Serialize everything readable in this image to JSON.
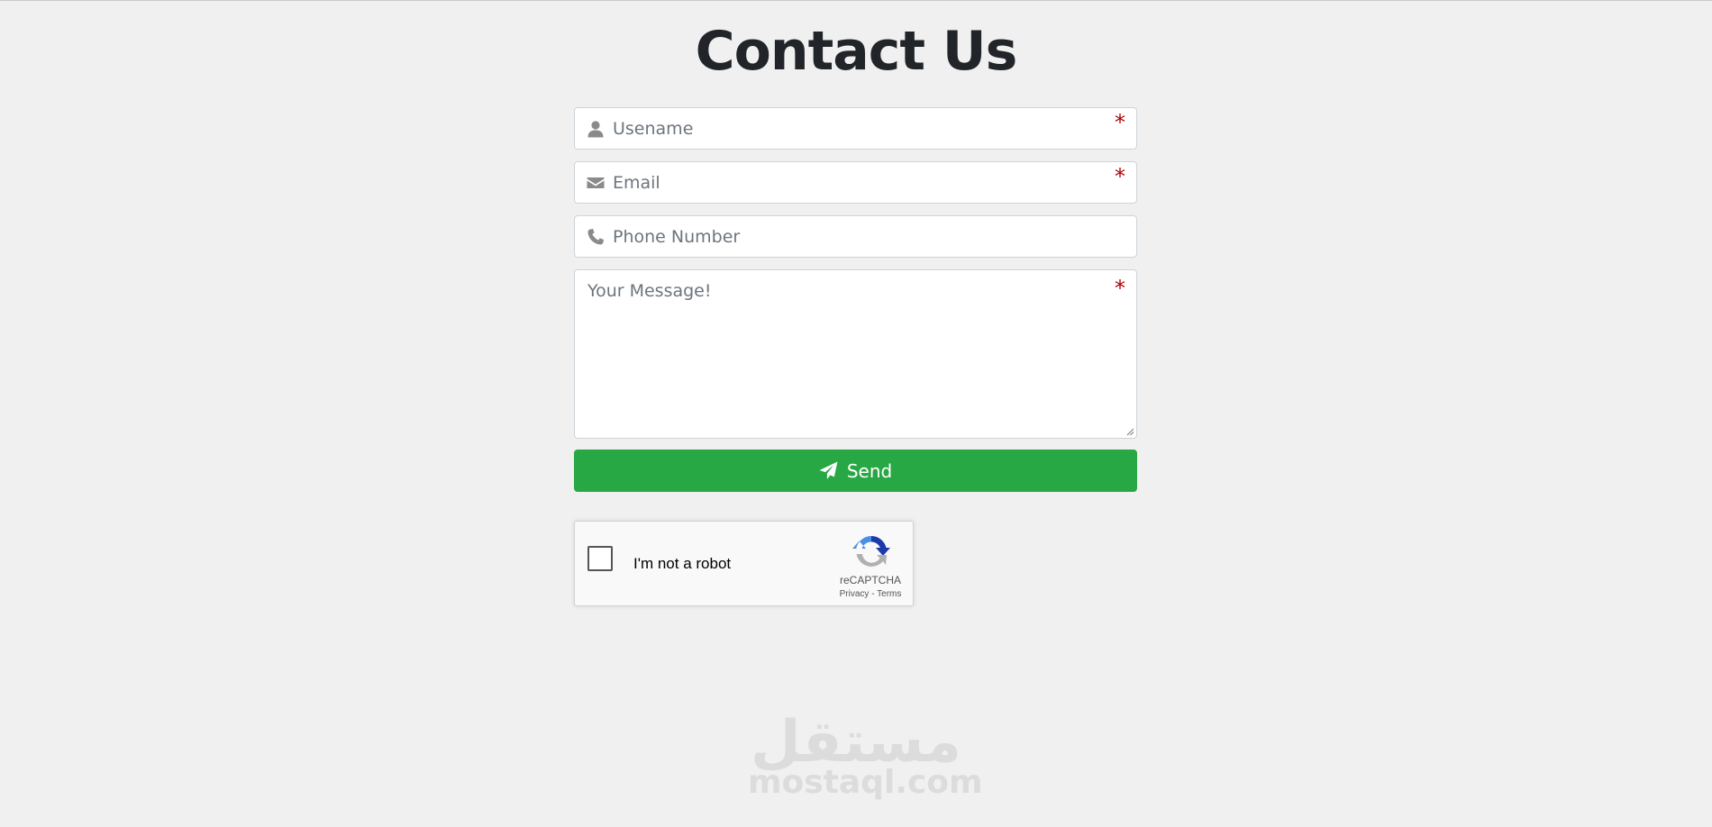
{
  "page": {
    "title": "Contact Us"
  },
  "form": {
    "username": {
      "placeholder": "Usename",
      "icon": "user-icon",
      "required_mark": "*"
    },
    "email": {
      "placeholder": "Email",
      "icon": "envelope-icon",
      "required_mark": "*"
    },
    "phone": {
      "placeholder": "Phone Number",
      "icon": "phone-icon"
    },
    "message": {
      "placeholder": "Your Message!",
      "required_mark": "*"
    },
    "send": {
      "label": "Send",
      "icon": "paper-plane-icon"
    }
  },
  "captcha": {
    "label": "I'm not a robot",
    "brand": "reCAPTCHA",
    "privacy": "Privacy",
    "separator": " - ",
    "terms": "Terms",
    "checked": false
  },
  "watermark": {
    "arabic": "مستقل",
    "text": "mostaql.com"
  },
  "colors": {
    "background": "#f0f0f0",
    "send_button": "#28a745",
    "required_mark": "#b00000",
    "title": "#212529",
    "icon": "#8a8a8a"
  }
}
